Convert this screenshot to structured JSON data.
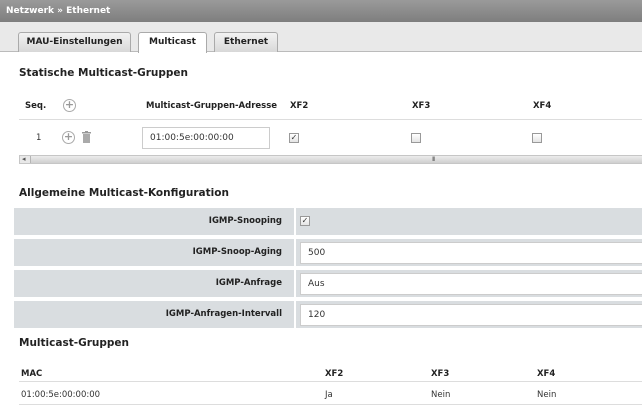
{
  "breadcrumb": {
    "part1": "Netzwerk",
    "sep": "»",
    "part2": "Ethernet"
  },
  "tabs": [
    {
      "label": "MAU-Einstellungen",
      "active": false
    },
    {
      "label": "Multicast",
      "active": true
    },
    {
      "label": "Ethernet",
      "active": false
    }
  ],
  "static_groups": {
    "title": "Statische Multicast-Gruppen",
    "headers": {
      "seq": "Seq.",
      "address": "Multicast-Gruppen-Adresse",
      "xf2": "XF2",
      "xf3": "XF3",
      "xf4": "XF4"
    },
    "rows": [
      {
        "seq": "1",
        "address": "01:00:5e:00:00:00",
        "xf2": true,
        "xf3": false,
        "xf4": false
      }
    ],
    "scrollbar_grip": "III"
  },
  "general_config": {
    "title": "Allgemeine Multicast-Konfiguration",
    "igmp_snooping_label": "IGMP-Snooping",
    "igmp_snooping_checked": true,
    "igmp_snoop_aging_label": "IGMP-Snoop-Aging",
    "igmp_snoop_aging_value": "500",
    "igmp_query_label": "IGMP-Anfrage",
    "igmp_query_value": "Aus",
    "igmp_query_interval_label": "IGMP-Anfragen-Intervall",
    "igmp_query_interval_value": "120"
  },
  "multicast_groups": {
    "title": "Multicast-Gruppen",
    "headers": {
      "mac": "MAC",
      "xf2": "XF2",
      "xf3": "XF3",
      "xf4": "XF4"
    },
    "rows": [
      {
        "mac": "01:00:5e:00:00:00",
        "xf2": "Ja",
        "xf3": "Nein",
        "xf4": "Nein"
      }
    ]
  },
  "colors": {
    "titlebar": "#888888",
    "config_row_bg": "#d9dde0"
  },
  "icons": {
    "add": "plus-circle-icon",
    "delete": "trash-icon",
    "check": "checkmark"
  }
}
